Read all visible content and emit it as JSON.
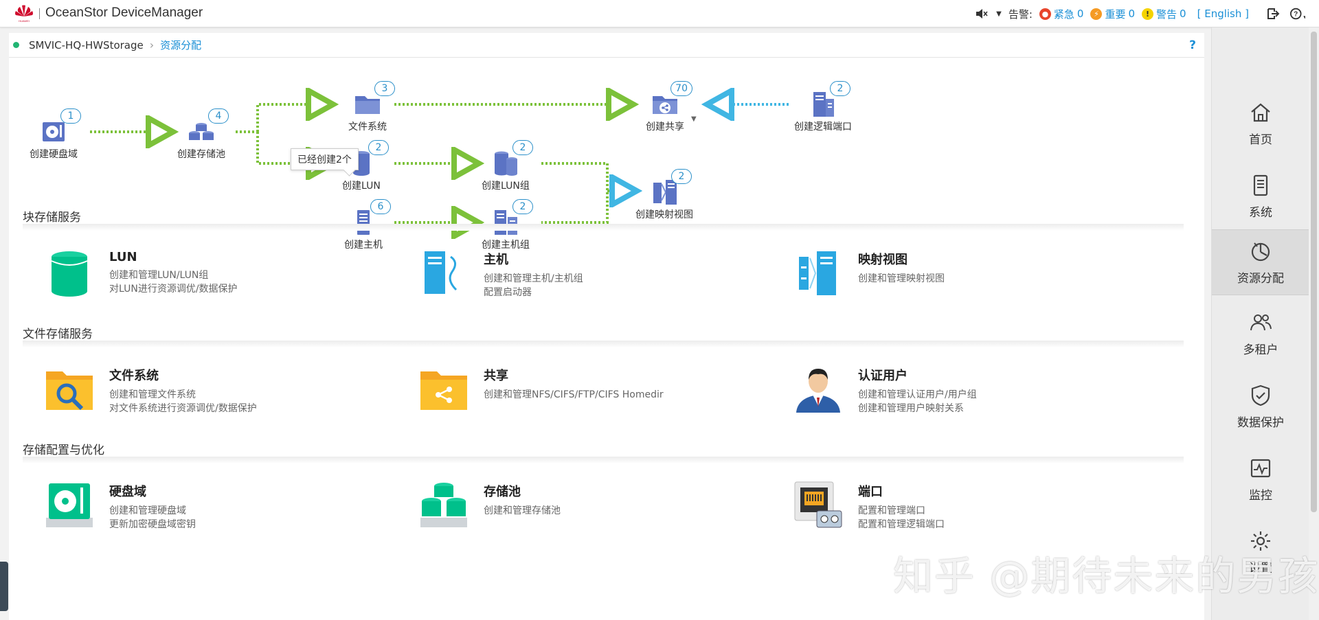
{
  "app": {
    "title": "OceanStor DeviceManager",
    "logo_text": "HUAWEI"
  },
  "topbar": {
    "alarm_label": "告警:",
    "critical": {
      "label": "紧急",
      "count": "0",
      "color": "#e8452c"
    },
    "major": {
      "label": "重要",
      "count": "0",
      "color": "#f59a23"
    },
    "warning": {
      "label": "警告",
      "count": "0",
      "color": "#f5d300"
    },
    "language": "[ English ]"
  },
  "breadcrumb": {
    "device": "SMVIC-HQ-HWStorage",
    "current": "资源分配",
    "help": "?"
  },
  "workflow": {
    "nodes": [
      {
        "id": "disk-domain",
        "label": "创建硬盘域",
        "count": "1"
      },
      {
        "id": "storage-pool",
        "label": "创建存储池",
        "count": "4"
      },
      {
        "id": "file-system",
        "label": "文件系统",
        "count": "3"
      },
      {
        "id": "lun",
        "label": "创建LUN",
        "count": "2"
      },
      {
        "id": "host",
        "label": "创建主机",
        "count": "6"
      },
      {
        "id": "lun-group",
        "label": "创建LUN组",
        "count": "2"
      },
      {
        "id": "host-group",
        "label": "创建主机组",
        "count": "2"
      },
      {
        "id": "share",
        "label": "创建共享",
        "count": "70"
      },
      {
        "id": "logical-port",
        "label": "创建逻辑端口",
        "count": "2"
      },
      {
        "id": "mapping-view",
        "label": "创建映射视图",
        "count": "2"
      }
    ],
    "tooltip": "已经创建2个"
  },
  "sections": [
    {
      "title": "块存储服务",
      "cards": [
        {
          "title": "LUN",
          "lines": [
            "创建和管理LUN/LUN组",
            "对LUN进行资源调优/数据保护"
          ]
        },
        {
          "title": "主机",
          "lines": [
            "创建和管理主机/主机组",
            "配置启动器"
          ]
        },
        {
          "title": "映射视图",
          "lines": [
            "创建和管理映射视图"
          ]
        }
      ]
    },
    {
      "title": "文件存储服务",
      "cards": [
        {
          "title": "文件系统",
          "lines": [
            "创建和管理文件系统",
            "对文件系统进行资源调优/数据保护"
          ]
        },
        {
          "title": "共享",
          "lines": [
            "创建和管理NFS/CIFS/FTP/CIFS Homedir"
          ]
        },
        {
          "title": "认证用户",
          "lines": [
            "创建和管理认证用户/用户组",
            "创建和管理用户映射关系"
          ]
        }
      ]
    },
    {
      "title": "存储配置与优化",
      "cards": [
        {
          "title": "硬盘域",
          "lines": [
            "创建和管理硬盘域",
            "更新加密硬盘域密钥"
          ]
        },
        {
          "title": "存储池",
          "lines": [
            "创建和管理存储池"
          ]
        },
        {
          "title": "端口",
          "lines": [
            "配置和管理端口",
            "配置和管理逻辑端口"
          ]
        }
      ]
    }
  ],
  "sidebar": {
    "items": [
      {
        "label": "首页",
        "icon": "home-icon"
      },
      {
        "label": "系统",
        "icon": "system-icon"
      },
      {
        "label": "资源分配",
        "icon": "provisioning-icon",
        "active": true
      },
      {
        "label": "多租户",
        "icon": "multi-tenant-icon"
      },
      {
        "label": "数据保护",
        "icon": "shield-icon"
      },
      {
        "label": "监控",
        "icon": "monitor-icon"
      },
      {
        "label": "设置",
        "icon": "settings-icon"
      }
    ]
  },
  "watermark": "知乎 @期待未来的男孩"
}
